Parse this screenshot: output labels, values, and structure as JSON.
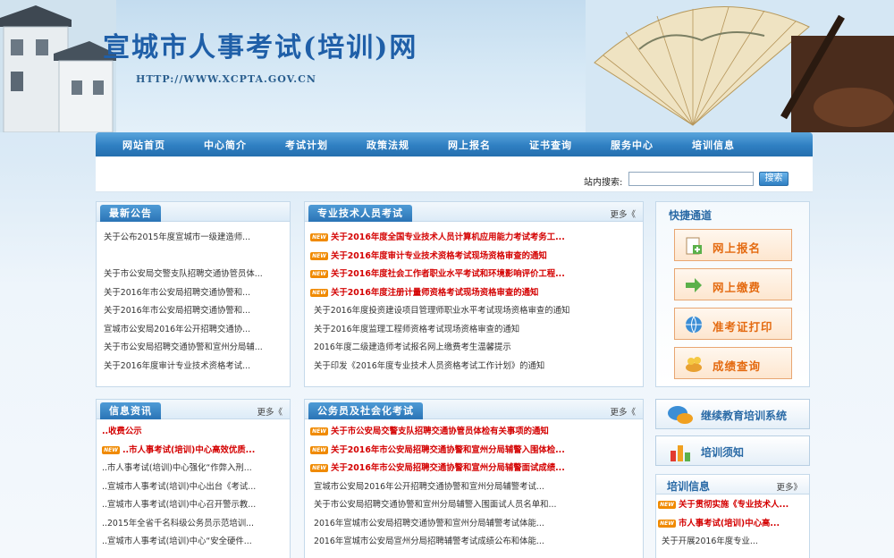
{
  "header": {
    "site_title": "宣城市人事考试(培训)网",
    "site_url": "HTTP://WWW.XCPTA.GOV.CN"
  },
  "nav": {
    "items": [
      "网站首页",
      "中心简介",
      "考试计划",
      "政策法规",
      "网上报名",
      "证书查询",
      "服务中心",
      "培训信息"
    ]
  },
  "search": {
    "label": "站内搜索:",
    "value": "",
    "button": "搜索"
  },
  "panels": {
    "announcements": {
      "title": "最新公告",
      "items": [
        "关于公布2015年度宣城市一级建造师...",
        "",
        "关于市公安局交警支队招聘交通协管员体...",
        "关于2016年市公安局招聘交通协警和...",
        "关于2016年市公安局招聘交通协警和...",
        "宣城市公安局2016年公开招聘交通协...",
        "关于市公安局招聘交通协警和宣州分局辅...",
        "关于2016年度审计专业技术资格考试..."
      ]
    },
    "professional": {
      "title": "专业技术人员考试",
      "more": "更多《",
      "items": [
        {
          "text": "关于2016年度全国专业技术人员计算机应用能力考试考务工...",
          "highlight": true
        },
        {
          "text": "关于2016年度审计专业技术资格考试现场资格审查的通知",
          "highlight": true
        },
        {
          "text": "关于2016年度社会工作者职业水平考试和环境影响评价工程...",
          "highlight": true
        },
        {
          "text": "关于2016年度注册计量师资格考试现场资格审查的通知",
          "highlight": true
        },
        {
          "text": "关于2016年度投资建设项目管理师职业水平考试现场资格审查的通知",
          "highlight": false
        },
        {
          "text": "关于2016年度监理工程师资格考试现场资格审查的通知",
          "highlight": false
        },
        {
          "text": "2016年度二级建造师考试报名网上缴费考生温馨提示",
          "highlight": false
        },
        {
          "text": "关于印发《2016年度专业技术人员资格考试工作计划》的通知",
          "highlight": false
        }
      ]
    },
    "quick": {
      "title": "快捷通道",
      "buttons": [
        "网上报名",
        "网上缴费",
        "准考证打印",
        "成绩查询"
      ]
    },
    "info": {
      "title": "信息资讯",
      "more": "更多《",
      "items": [
        {
          "text": "..收费公示",
          "highlight": true,
          "new": false
        },
        {
          "text": "..市人事考试(培训)中心高效优质...",
          "highlight": true,
          "new": true
        },
        {
          "text": "..市人事考试(培训)中心强化“作弊入刑...",
          "highlight": false,
          "new": false
        },
        {
          "text": "..宣城市人事考试(培训)中心出台《考试...",
          "highlight": false,
          "new": false
        },
        {
          "text": "..宣城市人事考试(培训)中心召开警示教...",
          "highlight": false,
          "new": false
        },
        {
          "text": "..2015年全省千名科级公务员示范培训...",
          "highlight": false,
          "new": false
        },
        {
          "text": "..宣城市人事考试(培训)中心“安全硬件...",
          "highlight": false,
          "new": false
        }
      ]
    },
    "civil": {
      "title": "公务员及社会化考试",
      "more": "更多《",
      "items": [
        {
          "text": "关于市公安局交警支队招聘交通协管员体检有关事项的通知",
          "highlight": true
        },
        {
          "text": "关于2016年市公安局招聘交通协警和宣州分局辅警入围体检...",
          "highlight": true
        },
        {
          "text": "关于2016年市公安局招聘交通协警和宣州分局辅警面试成绩...",
          "highlight": true
        },
        {
          "text": "宣城市公安局2016年公开招聘交通协警和宣州分局辅警考试...",
          "highlight": false
        },
        {
          "text": "关于市公安局招聘交通协警和宣州分局辅警入围面试人员名单和...",
          "highlight": false
        },
        {
          "text": "2016年宣城市公安局招聘交通协警和宣州分局辅警考试体能...",
          "highlight": false
        },
        {
          "text": "2016年宣城市公安局宣州分局招聘辅警考试成绩公布和体能...",
          "highlight": false
        }
      ]
    },
    "training_links": {
      "buttons": [
        "继续教育培训系统",
        "培训须知"
      ]
    },
    "training_info": {
      "title": "培训信息",
      "more": "更多》",
      "items": [
        {
          "text": "关于贯彻实施《专业技术人...",
          "highlight": true,
          "new": true
        },
        {
          "text": "市人事考试(培训)中心高...",
          "highlight": true,
          "new": true
        },
        {
          "text": "关于开展2016年度专业...",
          "highlight": false,
          "new": false
        }
      ]
    }
  },
  "colors": {
    "nav": "#2f7fc2",
    "highlight_text": "#d40000",
    "quick_text": "#e46a10",
    "new_badge": "#f08a00"
  }
}
